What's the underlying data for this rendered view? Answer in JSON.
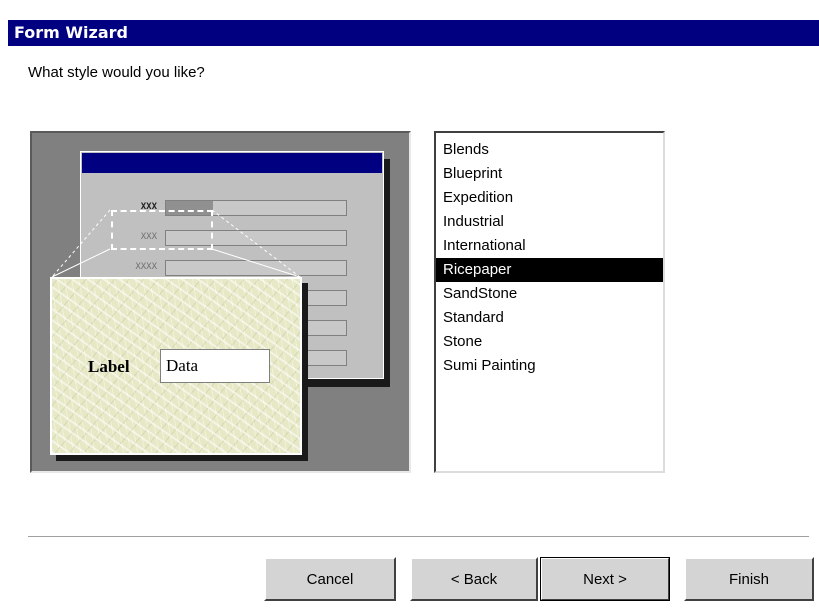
{
  "window": {
    "title": "Form Wizard"
  },
  "prompt": "What style would you like?",
  "preview": {
    "field_labels": [
      "XXX",
      "XXX",
      "XXXX"
    ],
    "sample_label": "Label",
    "sample_data": "Data"
  },
  "styles": {
    "items": [
      "Blends",
      "Blueprint",
      "Expedition",
      "Industrial",
      "International",
      "Ricepaper",
      "SandStone",
      "Standard",
      "Stone",
      "Sumi Painting"
    ],
    "selected": "Ricepaper"
  },
  "buttons": {
    "cancel": "Cancel",
    "back": "< Back",
    "next": "Next >",
    "finish": "Finish"
  },
  "colors": {
    "titlebar": "#000080",
    "selection": "#000000",
    "button_face": "#d4d4d4"
  }
}
